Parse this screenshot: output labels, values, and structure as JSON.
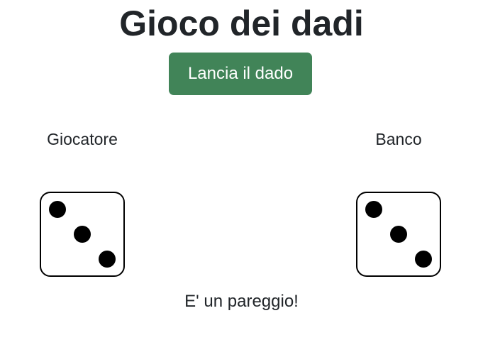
{
  "page": {
    "title": "Gioco dei dadi"
  },
  "controls": {
    "roll_button_label": "Lancia il dado",
    "button_color": "#418458"
  },
  "player": {
    "label": "Giocatore",
    "die_value": 3,
    "die_icon": "dice-three-icon"
  },
  "bank": {
    "label": "Banco",
    "die_value": 3,
    "die_icon": "dice-three-icon"
  },
  "result": {
    "message": "E' un pareggio!"
  }
}
